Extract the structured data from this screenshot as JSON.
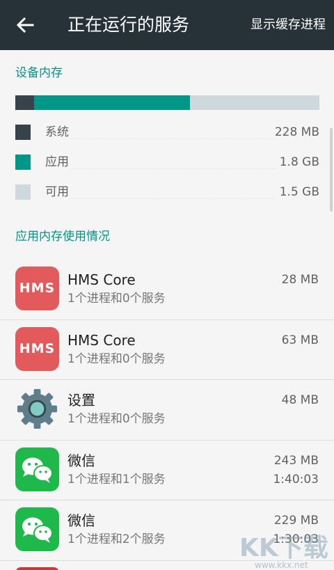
{
  "header": {
    "back_icon": "arrow-left-icon",
    "title": "正在运行的服务",
    "action": "显示缓存进程"
  },
  "memory": {
    "title": "设备内存",
    "bar": {
      "system_fraction": 0.061,
      "apps_fraction": 0.513
    },
    "legend": [
      {
        "label": "系统",
        "value": "228 MB",
        "color": "#37424a"
      },
      {
        "label": "应用",
        "value": "1.8 GB",
        "color": "#009688"
      },
      {
        "label": "可用",
        "value": "1.5 GB",
        "color": "#cfd8dc"
      }
    ]
  },
  "usage": {
    "title": "应用内存使用情况",
    "items": [
      {
        "name": "HMS Core",
        "detail": "1个进程和0个服务",
        "size": "28 MB",
        "icon": "hms-core-icon",
        "icon_text": "HMS"
      },
      {
        "name": "HMS Core",
        "detail": "1个进程和0个服务",
        "size": "63 MB",
        "icon": "hms-core-icon",
        "icon_text": "HMS"
      },
      {
        "name": "设置",
        "detail": "1个进程和0个服务",
        "size": "48 MB",
        "icon": "settings-gear-icon"
      },
      {
        "name": "微信",
        "detail": "1个进程和1个服务",
        "size": "243 MB",
        "time": "1:40:03",
        "icon": "wechat-icon"
      },
      {
        "name": "微信",
        "detail": "1个进程和2个服务",
        "size": "229 MB",
        "time": "1:30:03",
        "icon": "wechat-icon"
      }
    ]
  },
  "watermark": {
    "text": "KK下载",
    "url": "www.kkx.net"
  }
}
